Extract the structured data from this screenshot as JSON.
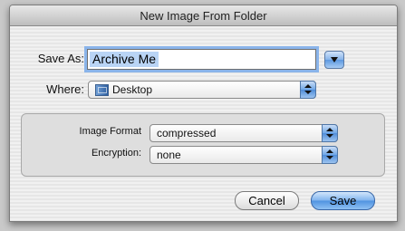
{
  "dialog": {
    "title": "New Image From Folder"
  },
  "save_as": {
    "label": "Save As:",
    "value": "Archive Me"
  },
  "where": {
    "label": "Where:",
    "value": "Desktop"
  },
  "options": {
    "image_format_label": "Image Format",
    "image_format_value": "compressed",
    "encryption_label": "Encryption:",
    "encryption_value": "none"
  },
  "buttons": {
    "cancel": "Cancel",
    "save": "Save"
  },
  "colors": {
    "focus_ring": "#8ab4ea",
    "selection": "#b9d4f5",
    "aqua_blue": "#4f92e0"
  },
  "icons": {
    "where_popup": "desktop-folder-icon",
    "disclosure": "disclosure-triangle-icon"
  }
}
